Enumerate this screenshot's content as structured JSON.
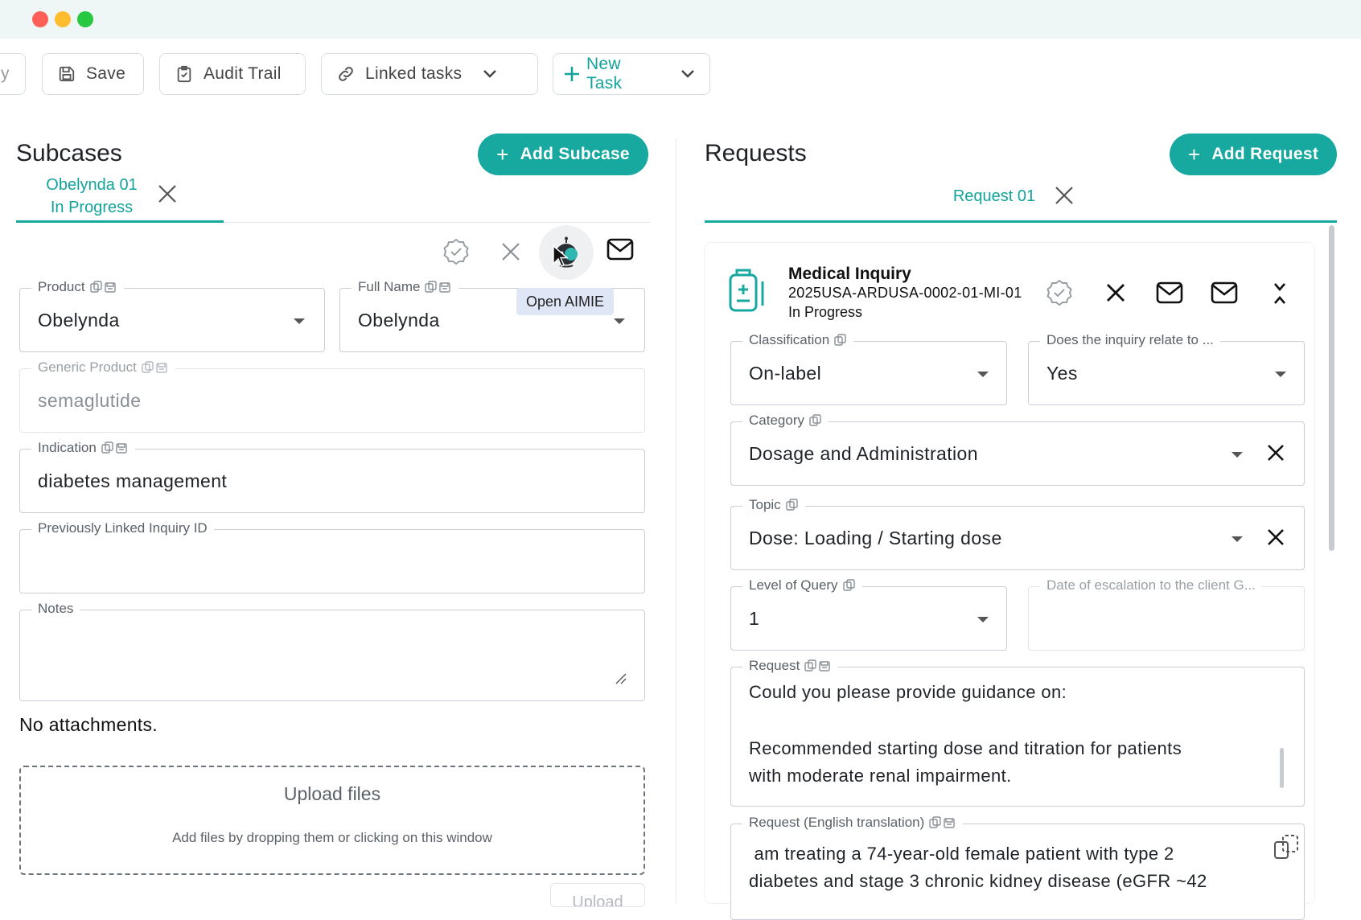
{
  "window": {
    "colors": {
      "accent": "#17a8a0",
      "accent_text": "#12a39b"
    }
  },
  "toolbar": {
    "partial_label": "y",
    "save_label": "Save",
    "audit_label": "Audit Trail",
    "linked_label": "Linked tasks",
    "new_task_label": "New Task"
  },
  "subcases": {
    "title": "Subcases",
    "add_label": "Add Subcase",
    "tab": {
      "name": "Obelynda 01",
      "status": "In Progress"
    },
    "tooltip": "Open AIMIE",
    "fields": {
      "product": {
        "label": "Product",
        "value": "Obelynda"
      },
      "full_name": {
        "label": "Full Name",
        "value": "Obelynda"
      },
      "generic": {
        "label": "Generic Product",
        "value": "semaglutide"
      },
      "indication": {
        "label": "Indication",
        "value": "diabetes management"
      },
      "prev_linked": {
        "label": "Previously Linked Inquiry ID",
        "value": ""
      },
      "notes": {
        "label": "Notes",
        "value": ""
      }
    },
    "attachments_text": "No attachments.",
    "upload": {
      "title": "Upload files",
      "hint": "Add files by dropping them or clicking on this window",
      "button": "Upload"
    }
  },
  "requests": {
    "title": "Requests",
    "add_label": "Add Request",
    "tab": {
      "name": "Request 01"
    },
    "card": {
      "type": "Medical Inquiry",
      "id": "2025USA-ARDUSA-0002-01-MI-01",
      "status": "In Progress"
    },
    "fields": {
      "classification": {
        "label": "Classification",
        "value": "On-label"
      },
      "relate": {
        "label": "Does the inquiry relate to ...",
        "value": "Yes"
      },
      "category": {
        "label": "Category",
        "value": "Dosage and Administration"
      },
      "topic": {
        "label": "Topic",
        "value": "Dose: Loading / Starting dose"
      },
      "level": {
        "label": "Level of Query",
        "value": "1"
      },
      "escalation": {
        "label": "Date of escalation to the client G...",
        "value": ""
      },
      "request": {
        "label": "Request",
        "line1": "Could you please provide guidance on:",
        "line2": "Recommended starting dose and titration for patients",
        "line3": "with moderate renal impairment."
      },
      "translation": {
        "label": "Request (English translation)",
        "line1": " am treating a 74-year-old female patient with type 2",
        "line2": "diabetes and stage 3 chronic kidney disease (eGFR ~42"
      }
    }
  }
}
